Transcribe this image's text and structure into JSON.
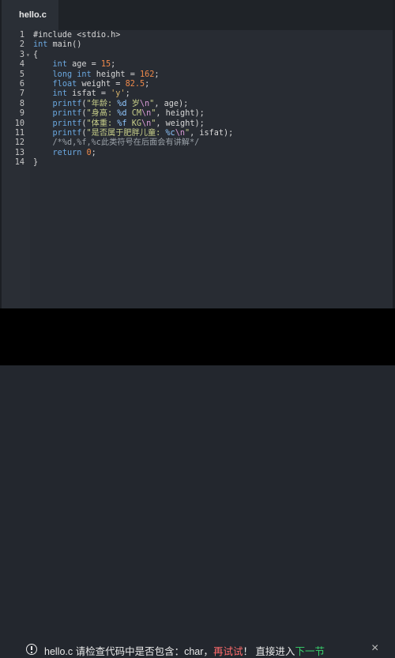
{
  "tab": {
    "title": "hello.c"
  },
  "editor": {
    "lines": [
      {
        "num": "1",
        "fold": "",
        "tokens": [
          {
            "t": "#include <stdio.h>",
            "c": ""
          }
        ]
      },
      {
        "num": "2",
        "fold": "",
        "tokens": [
          {
            "t": "int",
            "c": "kw"
          },
          {
            "t": " main()",
            "c": ""
          }
        ]
      },
      {
        "num": "3",
        "fold": "▾",
        "tokens": [
          {
            "t": "{",
            "c": ""
          }
        ]
      },
      {
        "num": "4",
        "fold": "",
        "tokens": [
          {
            "t": "    ",
            "c": ""
          },
          {
            "t": "int",
            "c": "kw"
          },
          {
            "t": " age = ",
            "c": ""
          },
          {
            "t": "15",
            "c": "num"
          },
          {
            "t": ";",
            "c": ""
          }
        ]
      },
      {
        "num": "5",
        "fold": "",
        "tokens": [
          {
            "t": "    ",
            "c": ""
          },
          {
            "t": "long int",
            "c": "kw"
          },
          {
            "t": " height = ",
            "c": ""
          },
          {
            "t": "162",
            "c": "num"
          },
          {
            "t": ";",
            "c": ""
          }
        ]
      },
      {
        "num": "6",
        "fold": "",
        "tokens": [
          {
            "t": "    ",
            "c": ""
          },
          {
            "t": "float",
            "c": "kw"
          },
          {
            "t": " weight = ",
            "c": ""
          },
          {
            "t": "82.5",
            "c": "num"
          },
          {
            "t": ";",
            "c": ""
          }
        ]
      },
      {
        "num": "7",
        "fold": "",
        "tokens": [
          {
            "t": "    ",
            "c": ""
          },
          {
            "t": "int",
            "c": "kw"
          },
          {
            "t": " isfat = ",
            "c": ""
          },
          {
            "t": "'y'",
            "c": "str"
          },
          {
            "t": ";",
            "c": ""
          }
        ]
      },
      {
        "num": "8",
        "fold": "",
        "tokens": [
          {
            "t": "    ",
            "c": ""
          },
          {
            "t": "printf",
            "c": "kw"
          },
          {
            "t": "(",
            "c": ""
          },
          {
            "t": "\"年龄: ",
            "c": "str2"
          },
          {
            "t": "%d",
            "c": "pct"
          },
          {
            "t": " 岁",
            "c": "str2"
          },
          {
            "t": "\\n",
            "c": "esc"
          },
          {
            "t": "\"",
            "c": "str2"
          },
          {
            "t": ", age);",
            "c": ""
          }
        ]
      },
      {
        "num": "9",
        "fold": "",
        "tokens": [
          {
            "t": "    ",
            "c": ""
          },
          {
            "t": "printf",
            "c": "kw"
          },
          {
            "t": "(",
            "c": ""
          },
          {
            "t": "\"身高: ",
            "c": "str2"
          },
          {
            "t": "%d",
            "c": "pct"
          },
          {
            "t": " CM",
            "c": "str2"
          },
          {
            "t": "\\n",
            "c": "esc"
          },
          {
            "t": "\"",
            "c": "str2"
          },
          {
            "t": ", height);",
            "c": ""
          }
        ]
      },
      {
        "num": "10",
        "fold": "",
        "tokens": [
          {
            "t": "    ",
            "c": ""
          },
          {
            "t": "printf",
            "c": "kw"
          },
          {
            "t": "(",
            "c": ""
          },
          {
            "t": "\"体重: ",
            "c": "str2"
          },
          {
            "t": "%f",
            "c": "pct"
          },
          {
            "t": " KG",
            "c": "str2"
          },
          {
            "t": "\\n",
            "c": "esc"
          },
          {
            "t": "\"",
            "c": "str2"
          },
          {
            "t": ", weight);",
            "c": ""
          }
        ]
      },
      {
        "num": "11",
        "fold": "",
        "tokens": [
          {
            "t": "    ",
            "c": ""
          },
          {
            "t": "printf",
            "c": "kw"
          },
          {
            "t": "(",
            "c": ""
          },
          {
            "t": "\"是否属于肥胖儿童: ",
            "c": "str2"
          },
          {
            "t": "%c",
            "c": "pct"
          },
          {
            "t": "\\n",
            "c": "esc"
          },
          {
            "t": "\"",
            "c": "str2"
          },
          {
            "t": ", isfat);",
            "c": ""
          }
        ]
      },
      {
        "num": "12",
        "fold": "",
        "tokens": [
          {
            "t": "    ",
            "c": ""
          },
          {
            "t": "/*%d,%f,%c此类符号在后面会有讲解*/",
            "c": "cm"
          }
        ]
      },
      {
        "num": "13",
        "fold": "",
        "tokens": [
          {
            "t": "    ",
            "c": ""
          },
          {
            "t": "return",
            "c": "kw"
          },
          {
            "t": " ",
            "c": ""
          },
          {
            "t": "0",
            "c": "num"
          },
          {
            "t": ";",
            "c": ""
          }
        ]
      },
      {
        "num": "14",
        "fold": "",
        "tokens": [
          {
            "t": "}",
            "c": ""
          }
        ]
      }
    ]
  },
  "toast": {
    "icon": "alert-circle-icon",
    "message_part1": "hello.c 请检查代码中是否包含：char，",
    "retry": "再试试",
    "message_part2": "！ 直接进入",
    "next": "下一节",
    "close_label": "×",
    "colors": {
      "retry": "#ff6b6b",
      "next": "#39d36d"
    }
  }
}
